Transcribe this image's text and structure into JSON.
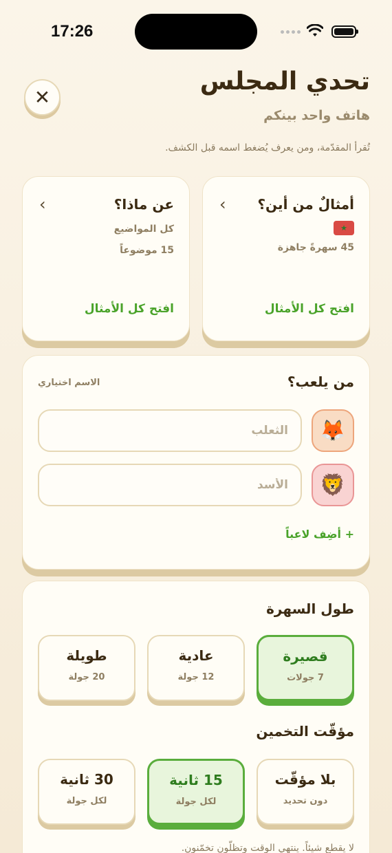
{
  "status": {
    "time": "17:26"
  },
  "header": {
    "title": "تحدي المجلس",
    "subtitle": "هاتف واحد بينكم",
    "intro": "تُقرأ المقدّمة، ومن يعرف يُضغط اسمه قبل الكشف."
  },
  "region_card": {
    "title": "أمثالٌ من أين؟",
    "detail": "45 سهرةً جاهزة",
    "link": "افتح كل الأمثال"
  },
  "topic_card": {
    "title": "عن ماذا؟",
    "line1": "كل المواضيع",
    "line2": "15 موضوعاً",
    "link": "افتح كل الأمثال"
  },
  "players": {
    "title": "من يلعب؟",
    "note": "الاسم اختياري",
    "list": [
      {
        "emoji": "🦊",
        "placeholder": "الثعلب",
        "value": ""
      },
      {
        "emoji": "🦁",
        "placeholder": "الأسد",
        "value": ""
      }
    ],
    "add_label": "+ أضِف لاعباً"
  },
  "session_length": {
    "title": "طول السهرة",
    "options": [
      {
        "label": "قصيرة",
        "sub": "7 جولات",
        "selected": true
      },
      {
        "label": "عادية",
        "sub": "12 جولة",
        "selected": false
      },
      {
        "label": "طويلة",
        "sub": "20 جولة",
        "selected": false
      }
    ]
  },
  "guess_timer": {
    "title": "مؤقّت التخمين",
    "options": [
      {
        "label": "بلا مؤقّت",
        "sub": "دون تحديد",
        "selected": false
      },
      {
        "label": "15 ثانية",
        "sub": "لكل جولة",
        "selected": true
      },
      {
        "label": "30 ثانية",
        "sub": "لكل جولة",
        "selected": false
      }
    ],
    "note": "لا يقطع شيئاً. ينتهي الوقت وتظلّون تخمّنون."
  },
  "colors": {
    "accent_green": "#4aa32a",
    "selected_bg": "#e8f5dc",
    "background": "#fbf5e9"
  }
}
